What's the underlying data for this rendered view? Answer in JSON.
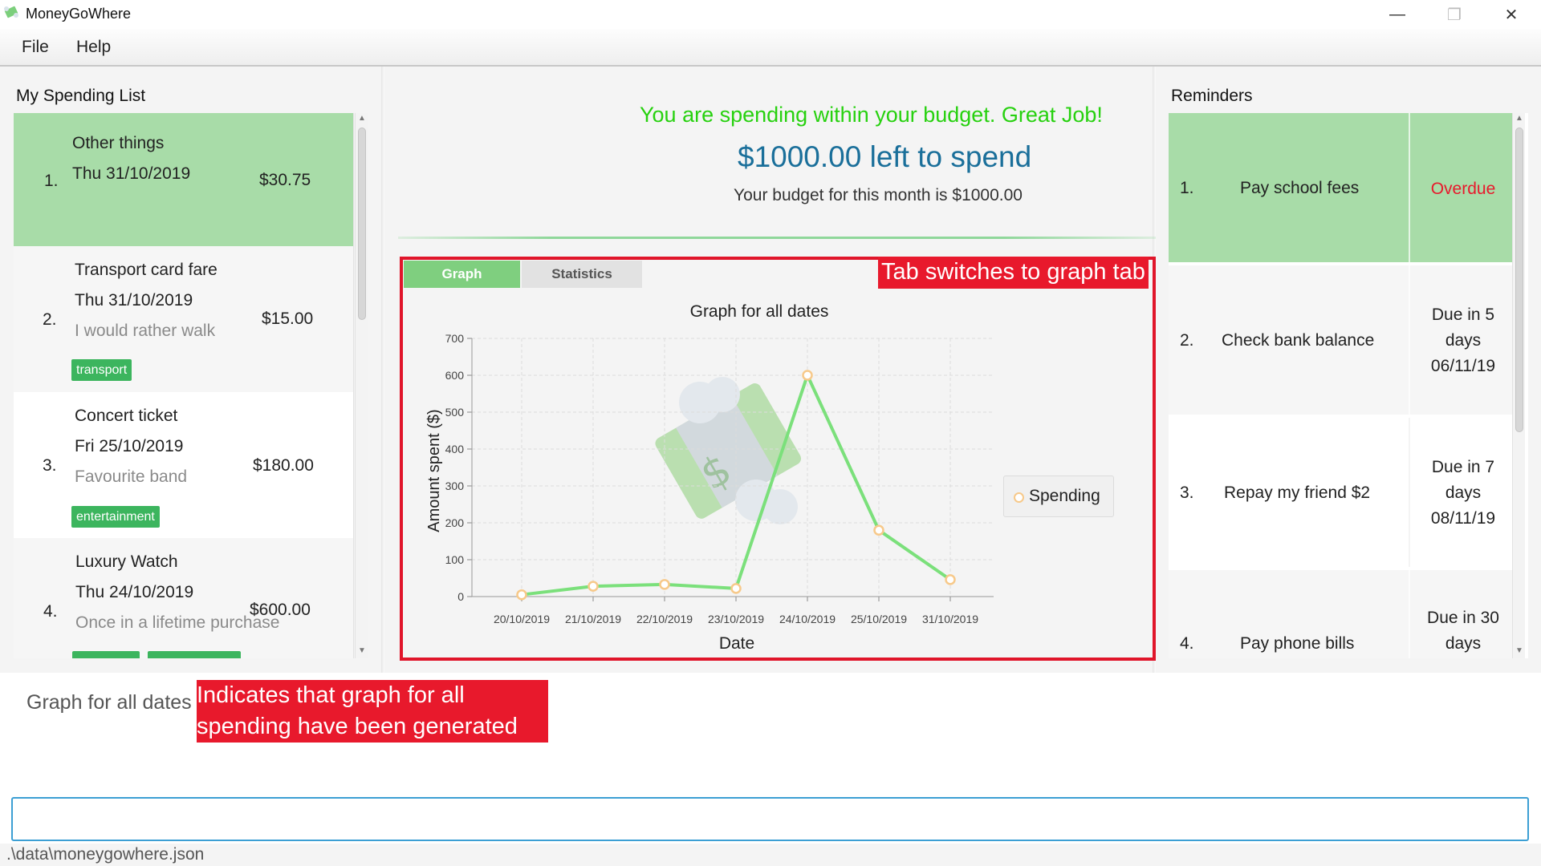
{
  "window": {
    "title": "MoneyGoWhere",
    "controls": {
      "minimize": "—",
      "maximize": "❐",
      "close": "✕"
    }
  },
  "menu": {
    "file": "File",
    "help": "Help"
  },
  "spending_list": {
    "title": "My Spending List",
    "items": [
      {
        "index": "1.",
        "name": "Other things",
        "date": "Thu 31/10/2019",
        "remark": "",
        "amount": "$30.75",
        "tags": []
      },
      {
        "index": "2.",
        "name": "Transport card fare",
        "date": "Thu 31/10/2019",
        "remark": "I would rather walk",
        "amount": "$15.00",
        "tags": [
          "transport"
        ]
      },
      {
        "index": "3.",
        "name": "Concert ticket",
        "date": "Fri 25/10/2019",
        "remark": "Favourite band",
        "amount": "$180.00",
        "tags": [
          "entertainment"
        ]
      },
      {
        "index": "4.",
        "name": "Luxury Watch",
        "date": "Thu 24/10/2019",
        "remark": "Once in a lifetime purchase",
        "amount": "$600.00",
        "tags": [
          "",
          ""
        ]
      }
    ]
  },
  "budget": {
    "message": "You are spending within your budget. Great Job!",
    "left_to_spend": "$1000.00 left to spend",
    "monthly_budget": "Your budget for this month is $1000.00"
  },
  "tabs": {
    "graph": "Graph",
    "statistics": "Statistics",
    "selected": "graph"
  },
  "annotations": {
    "tab": "Tab switches to graph tab",
    "result_line1": "Indicates that graph for all",
    "result_line2": "spending have been generated"
  },
  "chart_data": {
    "type": "line",
    "title": "Graph for all dates",
    "xlabel": "Date",
    "ylabel": "Amount spent ($)",
    "categories": [
      "20/10/2019",
      "21/10/2019",
      "22/10/2019",
      "23/10/2019",
      "24/10/2019",
      "25/10/2019",
      "31/10/2019"
    ],
    "series": [
      {
        "name": "Spending",
        "values": [
          5,
          28,
          33,
          22,
          600,
          180,
          46
        ],
        "color": "#7be07b",
        "marker_color": "#f7c98a"
      }
    ],
    "ylim": [
      0,
      700
    ],
    "yticks": [
      0,
      100,
      200,
      300,
      400,
      500,
      600,
      700
    ],
    "grid": true,
    "legend_position": "right"
  },
  "reminders": {
    "title": "Reminders",
    "items": [
      {
        "index": "1.",
        "description": "Pay school fees",
        "due_lines": [
          "Overdue"
        ],
        "overdue": true
      },
      {
        "index": "2.",
        "description": "Check bank balance",
        "due_lines": [
          "Due in 5",
          "days",
          "06/11/19"
        ],
        "overdue": false
      },
      {
        "index": "3.",
        "description": "Repay my friend $2",
        "due_lines": [
          "Due in 7",
          "days",
          "08/11/19"
        ],
        "overdue": false
      },
      {
        "index": "4.",
        "description": "Pay phone bills",
        "due_lines": [
          "Due in 30",
          "days"
        ],
        "overdue": false
      }
    ]
  },
  "result_display": {
    "text": "Graph for all dates"
  },
  "command_box": {
    "value": ""
  },
  "status_bar": {
    "path": ".\\data\\moneygowhere.json"
  },
  "colors": {
    "selected_row": "#a8dca8",
    "tag": "#3cb55e",
    "budget_ok": "#27d10f",
    "left_to_spend": "#1a6f9a",
    "overdue": "#e8192c",
    "annotation": "#e8192c",
    "line": "#7be07b"
  }
}
